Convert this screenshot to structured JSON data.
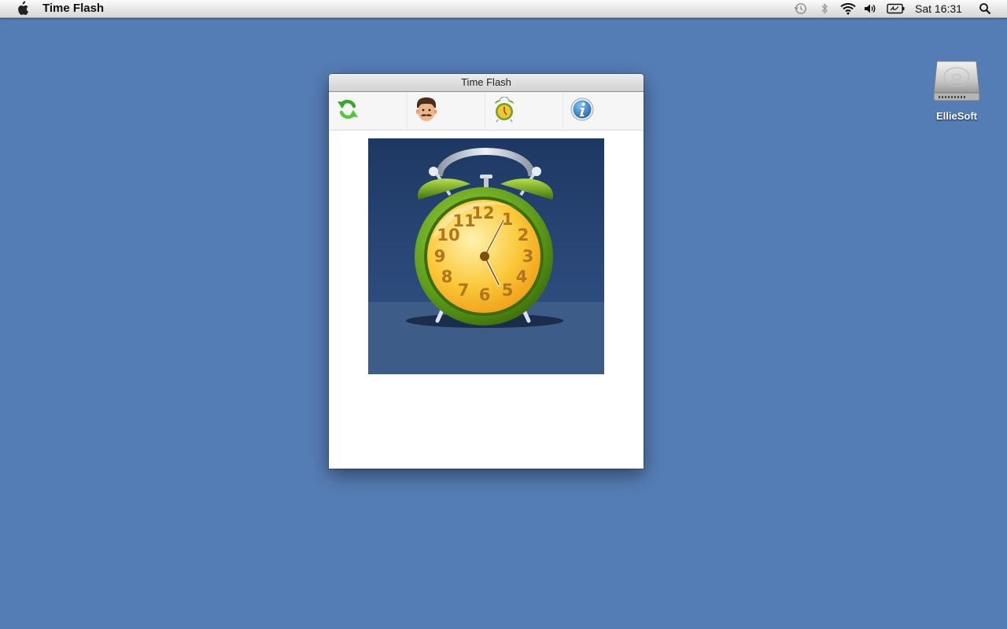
{
  "menubar": {
    "apple_icon": "apple-logo-icon",
    "app_name": "Time Flash",
    "status_icons": [
      "time-machine-icon",
      "bluetooth-icon",
      "wifi-icon",
      "volume-icon",
      "battery-icon",
      "spotlight-search-icon"
    ],
    "clock": "Sat 16:31"
  },
  "desktop": {
    "hard_drive_label": "EllieSoft"
  },
  "window": {
    "title": "Time Flash",
    "toolbar": [
      {
        "icon": "refresh-icon"
      },
      {
        "icon": "face-icon"
      },
      {
        "icon": "alarm-clock-icon"
      },
      {
        "icon": "info-icon"
      }
    ],
    "image": {
      "subject": "alarm-clock",
      "clock_numbers": [
        "12",
        "1",
        "2",
        "3",
        "4",
        "5",
        "6",
        "7",
        "8",
        "9",
        "10",
        "11"
      ]
    }
  },
  "colors": {
    "desktop": "#557db5",
    "clock_body": "#5e9c1a",
    "clock_face": "#f7b52a"
  }
}
